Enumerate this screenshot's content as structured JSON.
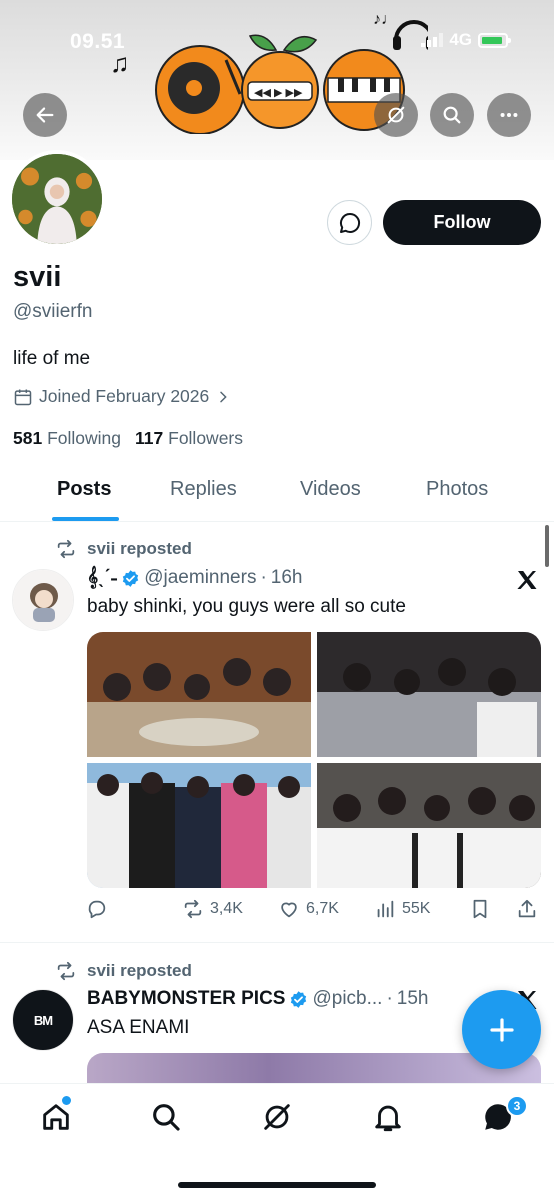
{
  "status_bar": {
    "time": "09.51",
    "network": "4G"
  },
  "profile": {
    "display_name": "svii",
    "handle": "@sviierfn",
    "bio": "life of me",
    "joined": "Joined February 2026",
    "following_count": "581",
    "following_label": "Following",
    "followers_count": "117",
    "followers_label": "Followers",
    "follow_label": "Follow"
  },
  "tabs": [
    {
      "label": "Posts",
      "active": true
    },
    {
      "label": "Replies",
      "active": false
    },
    {
      "label": "Videos",
      "active": false
    },
    {
      "label": "Photos",
      "active": false
    }
  ],
  "posts": [
    {
      "repost_label": "svii reposted",
      "author_name": "𝄞ˎˊ˗",
      "author_handle": "@jaeminners",
      "separator": "·",
      "time": "16h",
      "text": "baby shinki, you guys were all so cute",
      "replies": "",
      "reposts": "3,4K",
      "likes": "6,7K",
      "views": "55K"
    },
    {
      "repost_label": "svii reposted",
      "author_name": "BABYMONSTER PICS",
      "author_handle": "@picb...",
      "separator": "·",
      "time": "15h",
      "text": "ASA ENAMI",
      "avatar_text": "BM"
    }
  ],
  "notifications": {
    "messages_badge": "3"
  },
  "colors": {
    "accent": "#1d9bf0",
    "text": "#0f1419",
    "muted": "#536471"
  }
}
